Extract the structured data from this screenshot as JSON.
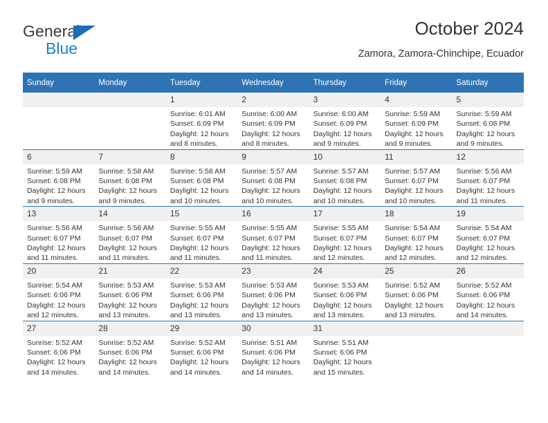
{
  "brand": {
    "name_part1": "General",
    "name_part2": "Blue",
    "triangle_color": "#1c6cb5",
    "blue_color": "#1b7fd4"
  },
  "header": {
    "title": "October 2024",
    "subtitle": "Zamora, Zamora-Chinchipe, Ecuador"
  },
  "theme": {
    "header_blue": "#2e74b5",
    "daynum_band": "#f0f0f0",
    "text": "#333333"
  },
  "calendar": {
    "weekday_headers": [
      "Sunday",
      "Monday",
      "Tuesday",
      "Wednesday",
      "Thursday",
      "Friday",
      "Saturday"
    ],
    "weeks": [
      [
        {
          "day": "",
          "lines": []
        },
        {
          "day": "",
          "lines": []
        },
        {
          "day": "1",
          "lines": [
            "Sunrise: 6:01 AM",
            "Sunset: 6:09 PM",
            "Daylight: 12 hours",
            "and 8 minutes."
          ]
        },
        {
          "day": "2",
          "lines": [
            "Sunrise: 6:00 AM",
            "Sunset: 6:09 PM",
            "Daylight: 12 hours",
            "and 8 minutes."
          ]
        },
        {
          "day": "3",
          "lines": [
            "Sunrise: 6:00 AM",
            "Sunset: 6:09 PM",
            "Daylight: 12 hours",
            "and 9 minutes."
          ]
        },
        {
          "day": "4",
          "lines": [
            "Sunrise: 5:59 AM",
            "Sunset: 6:09 PM",
            "Daylight: 12 hours",
            "and 9 minutes."
          ]
        },
        {
          "day": "5",
          "lines": [
            "Sunrise: 5:59 AM",
            "Sunset: 6:08 PM",
            "Daylight: 12 hours",
            "and 9 minutes."
          ]
        }
      ],
      [
        {
          "day": "6",
          "lines": [
            "Sunrise: 5:59 AM",
            "Sunset: 6:08 PM",
            "Daylight: 12 hours",
            "and 9 minutes."
          ]
        },
        {
          "day": "7",
          "lines": [
            "Sunrise: 5:58 AM",
            "Sunset: 6:08 PM",
            "Daylight: 12 hours",
            "and 9 minutes."
          ]
        },
        {
          "day": "8",
          "lines": [
            "Sunrise: 5:58 AM",
            "Sunset: 6:08 PM",
            "Daylight: 12 hours",
            "and 10 minutes."
          ]
        },
        {
          "day": "9",
          "lines": [
            "Sunrise: 5:57 AM",
            "Sunset: 6:08 PM",
            "Daylight: 12 hours",
            "and 10 minutes."
          ]
        },
        {
          "day": "10",
          "lines": [
            "Sunrise: 5:57 AM",
            "Sunset: 6:08 PM",
            "Daylight: 12 hours",
            "and 10 minutes."
          ]
        },
        {
          "day": "11",
          "lines": [
            "Sunrise: 5:57 AM",
            "Sunset: 6:07 PM",
            "Daylight: 12 hours",
            "and 10 minutes."
          ]
        },
        {
          "day": "12",
          "lines": [
            "Sunrise: 5:56 AM",
            "Sunset: 6:07 PM",
            "Daylight: 12 hours",
            "and 11 minutes."
          ]
        }
      ],
      [
        {
          "day": "13",
          "lines": [
            "Sunrise: 5:56 AM",
            "Sunset: 6:07 PM",
            "Daylight: 12 hours",
            "and 11 minutes."
          ]
        },
        {
          "day": "14",
          "lines": [
            "Sunrise: 5:56 AM",
            "Sunset: 6:07 PM",
            "Daylight: 12 hours",
            "and 11 minutes."
          ]
        },
        {
          "day": "15",
          "lines": [
            "Sunrise: 5:55 AM",
            "Sunset: 6:07 PM",
            "Daylight: 12 hours",
            "and 11 minutes."
          ]
        },
        {
          "day": "16",
          "lines": [
            "Sunrise: 5:55 AM",
            "Sunset: 6:07 PM",
            "Daylight: 12 hours",
            "and 11 minutes."
          ]
        },
        {
          "day": "17",
          "lines": [
            "Sunrise: 5:55 AM",
            "Sunset: 6:07 PM",
            "Daylight: 12 hours",
            "and 12 minutes."
          ]
        },
        {
          "day": "18",
          "lines": [
            "Sunrise: 5:54 AM",
            "Sunset: 6:07 PM",
            "Daylight: 12 hours",
            "and 12 minutes."
          ]
        },
        {
          "day": "19",
          "lines": [
            "Sunrise: 5:54 AM",
            "Sunset: 6:07 PM",
            "Daylight: 12 hours",
            "and 12 minutes."
          ]
        }
      ],
      [
        {
          "day": "20",
          "lines": [
            "Sunrise: 5:54 AM",
            "Sunset: 6:06 PM",
            "Daylight: 12 hours",
            "and 12 minutes."
          ]
        },
        {
          "day": "21",
          "lines": [
            "Sunrise: 5:53 AM",
            "Sunset: 6:06 PM",
            "Daylight: 12 hours",
            "and 13 minutes."
          ]
        },
        {
          "day": "22",
          "lines": [
            "Sunrise: 5:53 AM",
            "Sunset: 6:06 PM",
            "Daylight: 12 hours",
            "and 13 minutes."
          ]
        },
        {
          "day": "23",
          "lines": [
            "Sunrise: 5:53 AM",
            "Sunset: 6:06 PM",
            "Daylight: 12 hours",
            "and 13 minutes."
          ]
        },
        {
          "day": "24",
          "lines": [
            "Sunrise: 5:53 AM",
            "Sunset: 6:06 PM",
            "Daylight: 12 hours",
            "and 13 minutes."
          ]
        },
        {
          "day": "25",
          "lines": [
            "Sunrise: 5:52 AM",
            "Sunset: 6:06 PM",
            "Daylight: 12 hours",
            "and 13 minutes."
          ]
        },
        {
          "day": "26",
          "lines": [
            "Sunrise: 5:52 AM",
            "Sunset: 6:06 PM",
            "Daylight: 12 hours",
            "and 14 minutes."
          ]
        }
      ],
      [
        {
          "day": "27",
          "lines": [
            "Sunrise: 5:52 AM",
            "Sunset: 6:06 PM",
            "Daylight: 12 hours",
            "and 14 minutes."
          ]
        },
        {
          "day": "28",
          "lines": [
            "Sunrise: 5:52 AM",
            "Sunset: 6:06 PM",
            "Daylight: 12 hours",
            "and 14 minutes."
          ]
        },
        {
          "day": "29",
          "lines": [
            "Sunrise: 5:52 AM",
            "Sunset: 6:06 PM",
            "Daylight: 12 hours",
            "and 14 minutes."
          ]
        },
        {
          "day": "30",
          "lines": [
            "Sunrise: 5:51 AM",
            "Sunset: 6:06 PM",
            "Daylight: 12 hours",
            "and 14 minutes."
          ]
        },
        {
          "day": "31",
          "lines": [
            "Sunrise: 5:51 AM",
            "Sunset: 6:06 PM",
            "Daylight: 12 hours",
            "and 15 minutes."
          ]
        },
        {
          "day": "",
          "lines": []
        },
        {
          "day": "",
          "lines": []
        }
      ]
    ]
  }
}
